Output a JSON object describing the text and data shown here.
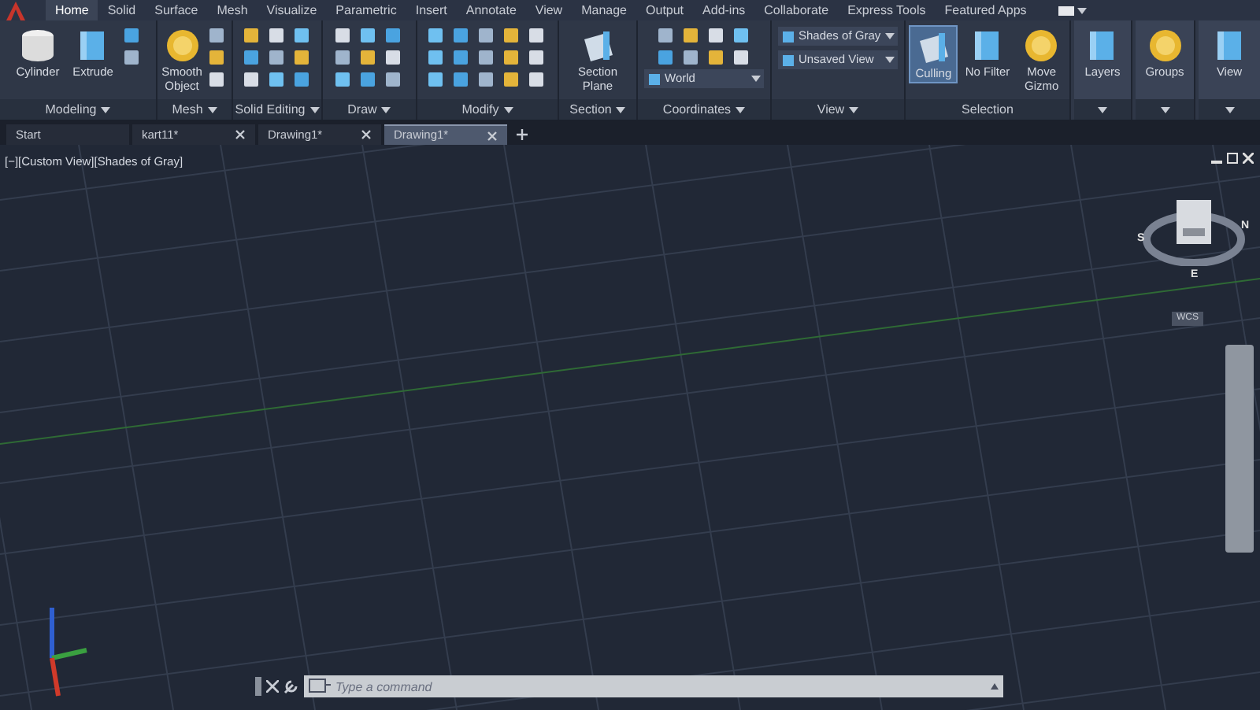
{
  "ribbon_tabs": [
    {
      "label": "Home",
      "selected": true
    },
    {
      "label": "Solid",
      "selected": false
    },
    {
      "label": "Surface",
      "selected": false
    },
    {
      "label": "Mesh",
      "selected": false
    },
    {
      "label": "Visualize",
      "selected": false
    },
    {
      "label": "Parametric",
      "selected": false
    },
    {
      "label": "Insert",
      "selected": false
    },
    {
      "label": "Annotate",
      "selected": false
    },
    {
      "label": "View",
      "selected": false
    },
    {
      "label": "Manage",
      "selected": false
    },
    {
      "label": "Output",
      "selected": false
    },
    {
      "label": "Add-ins",
      "selected": false
    },
    {
      "label": "Collaborate",
      "selected": false
    },
    {
      "label": "Express Tools",
      "selected": false
    },
    {
      "label": "Featured Apps",
      "selected": false
    }
  ],
  "panels": [
    {
      "title": "Modeling",
      "menu": true,
      "buttons": [
        {
          "label": "Cylinder",
          "on": false
        },
        {
          "label": "Extrude",
          "on": false
        }
      ]
    },
    {
      "title": "Mesh",
      "menu": true,
      "buttons": [
        {
          "label": "Smooth Object",
          "on": false
        }
      ]
    },
    {
      "title": "Solid Editing",
      "menu": true
    },
    {
      "title": "Draw",
      "menu": true
    },
    {
      "title": "Modify",
      "menu": true
    },
    {
      "title": "Section",
      "menu": true,
      "buttons": [
        {
          "label": "Section Plane",
          "on": false
        }
      ]
    },
    {
      "title": "Coordinates",
      "menu": true,
      "dropdowns": [
        {
          "value": "World"
        }
      ]
    },
    {
      "title": "View",
      "menu": true,
      "dropdowns": [
        {
          "value": "Shades of Gray"
        },
        {
          "value": "Unsaved View"
        }
      ]
    },
    {
      "title": "Selection",
      "buttons": [
        {
          "label": "Culling",
          "on": true
        },
        {
          "label": "No Filter",
          "on": false
        },
        {
          "label": "Move Gizmo",
          "on": false
        }
      ]
    },
    {
      "menu": true,
      "buttons": [
        {
          "label": "Layers",
          "on": false
        }
      ]
    },
    {
      "menu": true,
      "buttons": [
        {
          "label": "Groups",
          "on": false
        }
      ]
    },
    {
      "menu": true,
      "buttons": [
        {
          "label": "View",
          "on": false
        }
      ]
    }
  ],
  "doc_tabs": [
    {
      "label": "Start",
      "selected": false
    },
    {
      "label": "kart11*",
      "selected": false
    },
    {
      "label": "Drawing1*",
      "selected": false
    },
    {
      "label": "Drawing1*",
      "selected": true
    }
  ],
  "viewport": {
    "label": "[−][Custom View][Shades of Gray]",
    "viewcube": {
      "compass": [
        "S",
        "N",
        "E"
      ],
      "ucs": "WCS"
    }
  },
  "command_line": {
    "placeholder": "Type a command"
  }
}
